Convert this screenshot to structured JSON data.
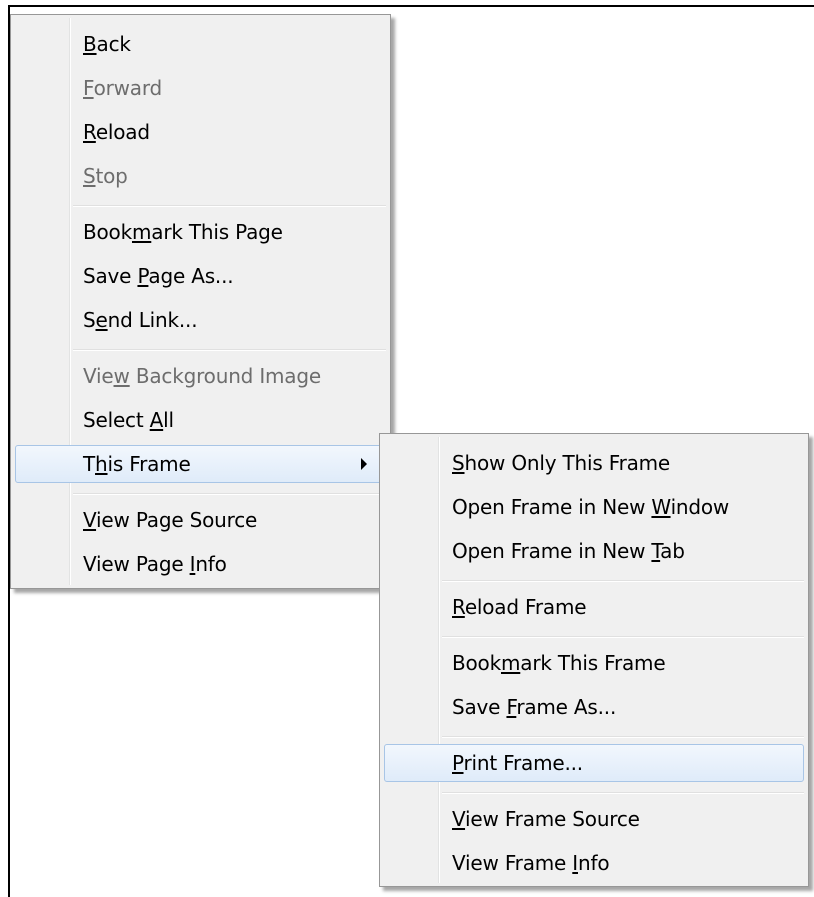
{
  "main_menu": {
    "groups": [
      [
        {
          "id": "back",
          "pre": "",
          "key": "B",
          "post": "ack",
          "disabled": false
        },
        {
          "id": "forward",
          "pre": "",
          "key": "F",
          "post": "orward",
          "disabled": true
        },
        {
          "id": "reload",
          "pre": "",
          "key": "R",
          "post": "eload",
          "disabled": false
        },
        {
          "id": "stop",
          "pre": "",
          "key": "S",
          "post": "top",
          "disabled": true
        }
      ],
      [
        {
          "id": "bookmark-this-page",
          "pre": "Book",
          "key": "m",
          "post": "ark This Page",
          "disabled": false
        },
        {
          "id": "save-page-as",
          "pre": "Save ",
          "key": "P",
          "post": "age As...",
          "disabled": false
        },
        {
          "id": "send-link",
          "pre": "S",
          "key": "e",
          "post": "nd Link...",
          "disabled": false
        }
      ],
      [
        {
          "id": "view-background-image",
          "pre": "Vie",
          "key": "w",
          "post": " Background Image",
          "disabled": true
        },
        {
          "id": "select-all",
          "pre": "Select ",
          "key": "A",
          "post": "ll",
          "disabled": false
        },
        {
          "id": "this-frame",
          "pre": "T",
          "key": "h",
          "post": "is Frame",
          "disabled": false,
          "highlighted": true,
          "submenu": true
        }
      ],
      [
        {
          "id": "view-page-source",
          "pre": "",
          "key": "V",
          "post": "iew Page Source",
          "disabled": false
        },
        {
          "id": "view-page-info",
          "pre": "View Page ",
          "key": "I",
          "post": "nfo",
          "disabled": false
        }
      ]
    ]
  },
  "sub_menu": {
    "groups": [
      [
        {
          "id": "show-only-this-frame",
          "pre": "",
          "key": "S",
          "post": "how Only This Frame",
          "disabled": false
        },
        {
          "id": "open-frame-in-new-window",
          "pre": "Open Frame in New ",
          "key": "W",
          "post": "indow",
          "disabled": false
        },
        {
          "id": "open-frame-in-new-tab",
          "pre": "Open Frame in New ",
          "key": "T",
          "post": "ab",
          "disabled": false
        }
      ],
      [
        {
          "id": "reload-frame",
          "pre": "",
          "key": "R",
          "post": "eload Frame",
          "disabled": false
        }
      ],
      [
        {
          "id": "bookmark-this-frame",
          "pre": "Book",
          "key": "m",
          "post": "ark This Frame",
          "disabled": false
        },
        {
          "id": "save-frame-as",
          "pre": "Save ",
          "key": "F",
          "post": "rame As...",
          "disabled": false
        }
      ],
      [
        {
          "id": "print-frame",
          "pre": "",
          "key": "P",
          "post": "rint Frame...",
          "disabled": false,
          "highlighted": true
        }
      ],
      [
        {
          "id": "view-frame-source",
          "pre": "",
          "key": "V",
          "post": "iew Frame Source",
          "disabled": false
        },
        {
          "id": "view-frame-info",
          "pre": "View Frame ",
          "key": "I",
          "post": "nfo",
          "disabled": false
        }
      ]
    ]
  }
}
